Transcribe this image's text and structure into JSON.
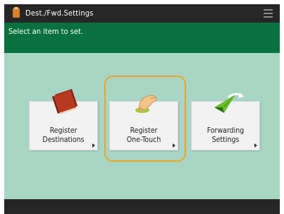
{
  "titlebar": {
    "title": "Dest./Fwd.Settings",
    "app_icon": "folder-book-icon",
    "menu_icon": "hamburger-menu-icon"
  },
  "instruction": {
    "text": "Select an item to set."
  },
  "tiles": [
    {
      "line1": "Register",
      "line2": "Destinations",
      "icon": "address-book-icon",
      "selected": false
    },
    {
      "line1": "Register",
      "line2": "One-Touch",
      "icon": "finger-press-icon",
      "selected": true
    },
    {
      "line1": "Forwarding",
      "line2": "Settings",
      "icon": "forward-plane-icon",
      "selected": false
    }
  ],
  "colors": {
    "background": "#a9d5c4",
    "titlebar": "#262626",
    "instruction_bar": "#08713f",
    "focus": "#f0a323"
  }
}
